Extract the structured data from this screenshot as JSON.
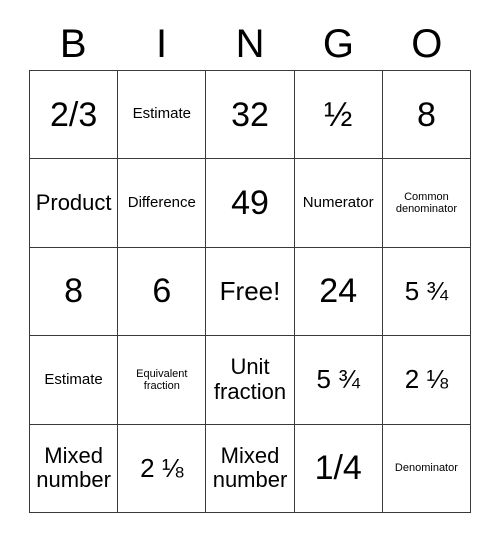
{
  "card": {
    "title": "BINGO",
    "headers": [
      "B",
      "I",
      "N",
      "G",
      "O"
    ],
    "free_space_label": "Free!",
    "border_color": "#3a3a3a",
    "background_color": "#ffffff",
    "text_color": "#000000",
    "rows": [
      [
        {
          "text": "2/3",
          "size": "xl"
        },
        {
          "text": "Estimate",
          "size": "sm"
        },
        {
          "text": "32",
          "size": "xl"
        },
        {
          "text": "½",
          "size": "xl"
        },
        {
          "text": "8",
          "size": "xl"
        }
      ],
      [
        {
          "text": "Product",
          "size": "md"
        },
        {
          "text": "Difference",
          "size": "sm"
        },
        {
          "text": "49",
          "size": "xl"
        },
        {
          "text": "Numerator",
          "size": "sm"
        },
        {
          "text": "Common denominator",
          "size": "xs"
        }
      ],
      [
        {
          "text": "8",
          "size": "xl"
        },
        {
          "text": "6",
          "size": "xl"
        },
        {
          "text": "Free!",
          "size": "lg"
        },
        {
          "text": "24",
          "size": "xl"
        },
        {
          "text": "5 ¾",
          "size": "lg"
        }
      ],
      [
        {
          "text": "Estimate",
          "size": "sm"
        },
        {
          "text": "Equivalent fraction",
          "size": "xs"
        },
        {
          "text": "Unit fraction",
          "size": "md"
        },
        {
          "text": "5 ¾",
          "size": "lg"
        },
        {
          "text": "2 ⅛",
          "size": "lg"
        }
      ],
      [
        {
          "text": "Mixed number",
          "size": "md"
        },
        {
          "text": "2 ⅛",
          "size": "lg"
        },
        {
          "text": "Mixed number",
          "size": "md"
        },
        {
          "text": "1/4",
          "size": "xl"
        },
        {
          "text": "Denominator",
          "size": "xs"
        }
      ]
    ]
  }
}
